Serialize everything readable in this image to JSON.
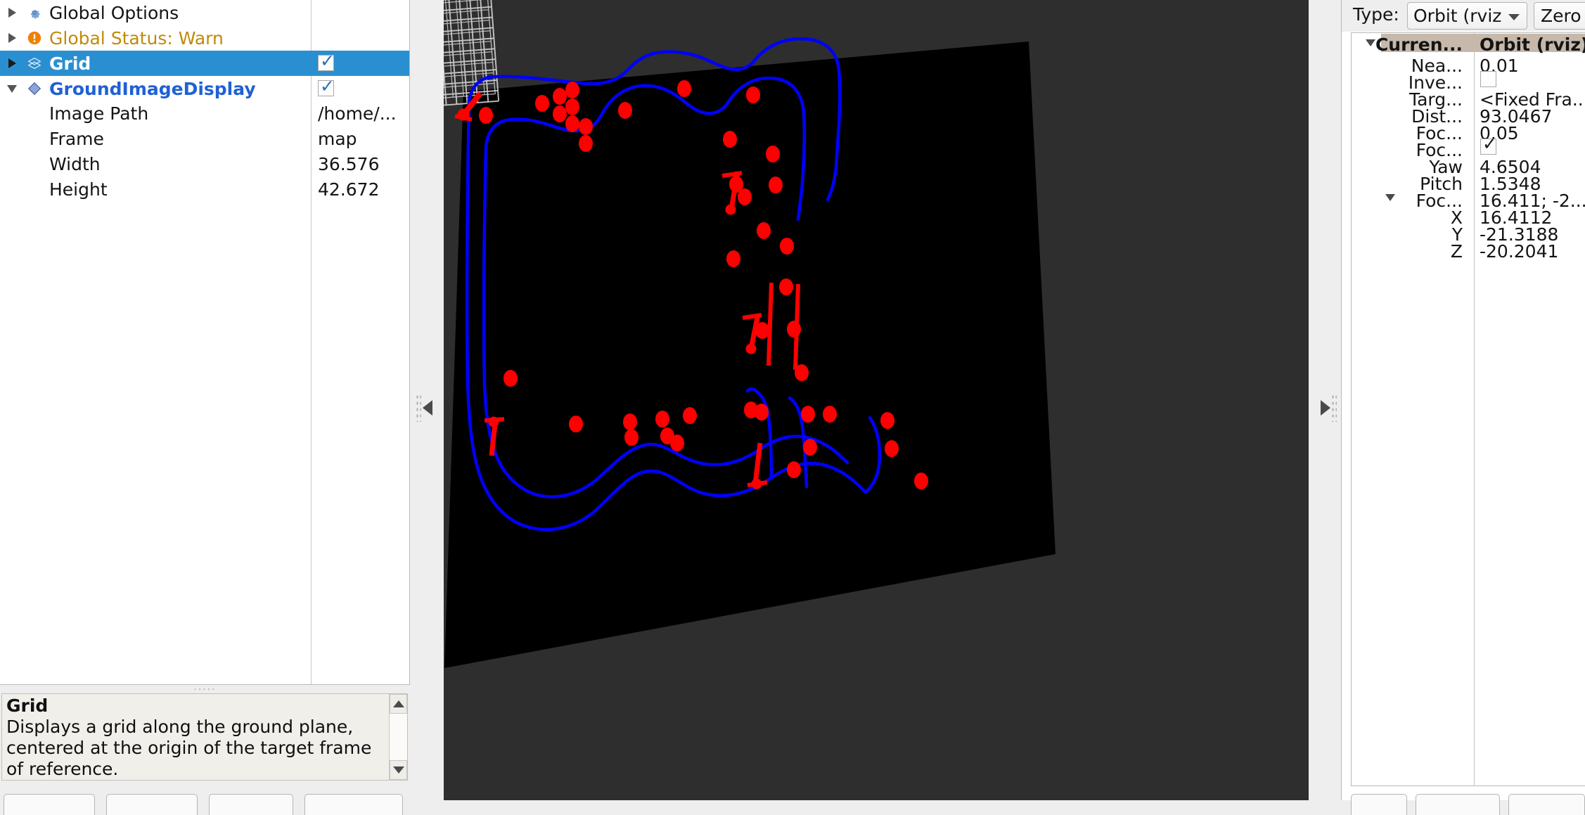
{
  "displays_panel": {
    "tree_rows": [
      {
        "label": "Global Options",
        "icon": "gear-icon",
        "expander": "collapsed",
        "style": "plain",
        "checkbox": null
      },
      {
        "label": "Global Status: Warn",
        "icon": "warning-icon",
        "expander": "collapsed",
        "style": "warn",
        "checkbox": null
      },
      {
        "label": "Grid",
        "icon": "grid-icon",
        "expander": "collapsed",
        "style": "display",
        "selected": true,
        "checkbox": "checked"
      },
      {
        "label": "GroundImageDisplay",
        "icon": "diamond-icon",
        "expander": "expanded",
        "style": "display",
        "checkbox": "checked"
      }
    ],
    "properties": [
      {
        "name": "Image Path",
        "value": "/home/..."
      },
      {
        "name": "Frame",
        "value": "map"
      },
      {
        "name": "Width",
        "value": "36.576"
      },
      {
        "name": "Height",
        "value": "42.672"
      }
    ],
    "description": {
      "title": "Grid",
      "body": "Displays a grid along the ground plane, centered at the origin of the target frame of reference."
    }
  },
  "views_panel": {
    "type_label": "Type:",
    "type_value": "Orbit (rviz",
    "zero_label": "Zero",
    "header": {
      "name": "Curren...",
      "value": "Orbit (rviz)"
    },
    "rows": [
      {
        "name": "Nea...",
        "value": "0.01",
        "kind": "text",
        "indent": 0
      },
      {
        "name": "Inve...",
        "value": "",
        "kind": "checkbox-unchecked",
        "indent": 0
      },
      {
        "name": "Targ...",
        "value": "<Fixed Fra...",
        "kind": "text",
        "indent": 0
      },
      {
        "name": "Dist...",
        "value": "93.0467",
        "kind": "text",
        "indent": 0
      },
      {
        "name": "Foc...",
        "value": "0.05",
        "kind": "text",
        "indent": 0
      },
      {
        "name": "Foc...",
        "value": "",
        "kind": "checkbox-checked",
        "indent": 0
      },
      {
        "name": "Yaw",
        "value": "4.6504",
        "kind": "text",
        "indent": 0
      },
      {
        "name": "Pitch",
        "value": "1.5348",
        "kind": "text",
        "indent": 0
      },
      {
        "name": "Foc...",
        "value": "16.411; -2...",
        "kind": "text",
        "indent": 0,
        "expander": "expanded"
      },
      {
        "name": "X",
        "value": "16.4112",
        "kind": "text",
        "indent": 1
      },
      {
        "name": "Y",
        "value": "-21.3188",
        "kind": "text",
        "indent": 1
      },
      {
        "name": "Z",
        "value": "-20.2041",
        "kind": "text",
        "indent": 1
      }
    ]
  },
  "viewport": {
    "background_color": "#2e2e2e",
    "ground_image_color": "#000000",
    "grid_line_color": "#cfcfcf",
    "track_line_color": "#0000ff",
    "marker_color": "#ff0000",
    "grid_cells": 10
  },
  "collapse_handles": {
    "left": "collapse-left-icon",
    "right": "collapse-right-icon"
  }
}
